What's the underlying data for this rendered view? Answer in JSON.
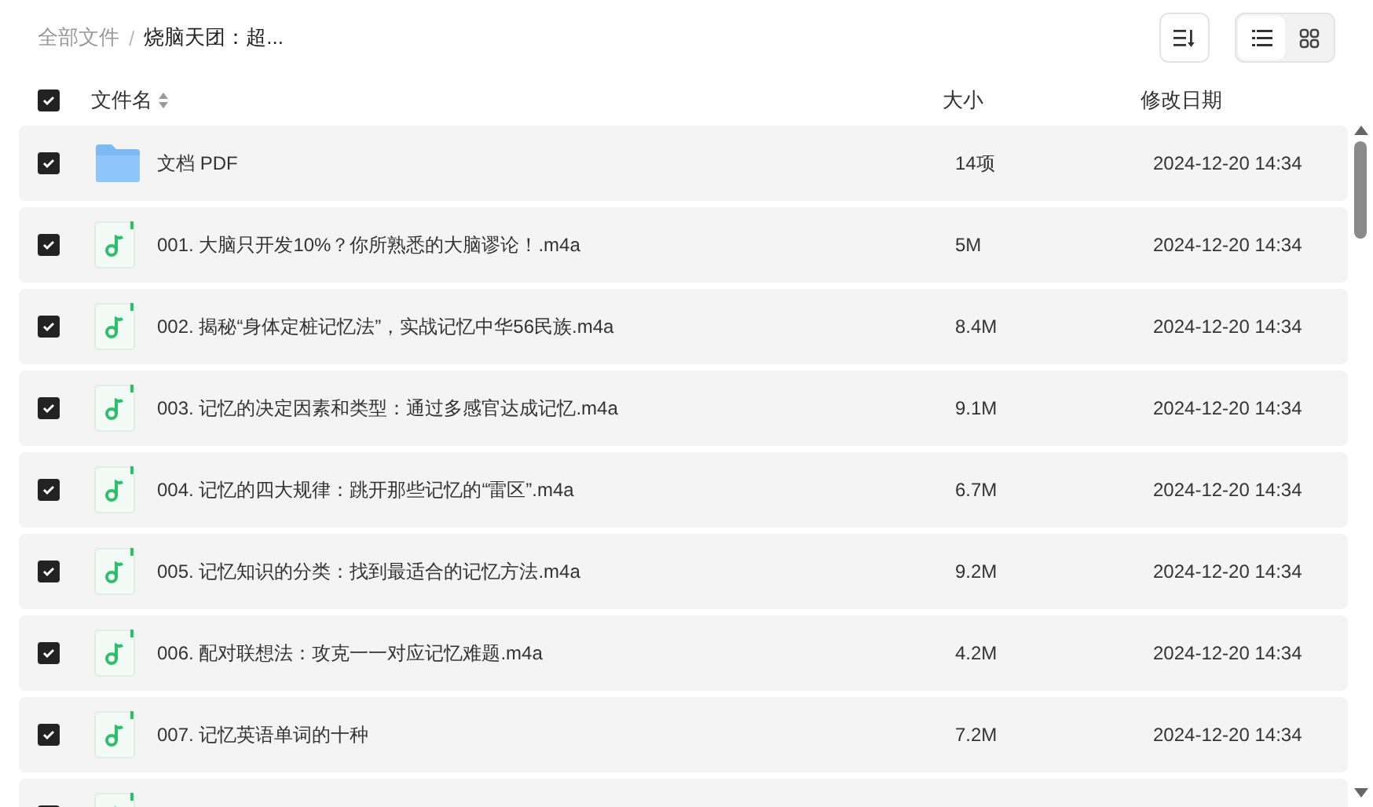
{
  "breadcrumb": {
    "separator": "/",
    "items": [
      {
        "label": "全部文件",
        "current": false
      },
      {
        "label": "烧脑天团：超...",
        "current": true
      }
    ]
  },
  "toolbar": {
    "views": [
      {
        "kind": "list",
        "selected": true
      },
      {
        "kind": "grid",
        "selected": false
      }
    ]
  },
  "header": {
    "checked": true,
    "columns": [
      "文件名",
      "大小",
      "修改日期"
    ]
  },
  "rows": [
    {
      "kind": "folder",
      "checked": true,
      "name": "文档 PDF",
      "size": "14项",
      "date": "2024-12-20 14:34"
    },
    {
      "kind": "audio",
      "checked": true,
      "name": "001. 大脑只开发10%？你所熟悉的大脑谬论！.m4a",
      "size": "5M",
      "date": "2024-12-20 14:34"
    },
    {
      "kind": "audio",
      "checked": true,
      "name": "002. 揭秘“身体定桩记忆法”，实战记忆中华56民族.m4a",
      "size": "8.4M",
      "date": "2024-12-20 14:34"
    },
    {
      "kind": "audio",
      "checked": true,
      "name": "003. 记忆的决定因素和类型：通过多感官达成记忆.m4a",
      "size": "9.1M",
      "date": "2024-12-20 14:34"
    },
    {
      "kind": "audio",
      "checked": true,
      "name": "004. 记忆的四大规律：跳开那些记忆的“雷区”.m4a",
      "size": "6.7M",
      "date": "2024-12-20 14:34"
    },
    {
      "kind": "audio",
      "checked": true,
      "name": "005. 记忆知识的分类：找到最适合的记忆方法.m4a",
      "size": "9.2M",
      "date": "2024-12-20 14:34"
    },
    {
      "kind": "audio",
      "checked": true,
      "name": "006. 配对联想法：攻克一一对应记忆难题.m4a",
      "size": "4.2M",
      "date": "2024-12-20 14:34"
    },
    {
      "kind": "audio",
      "checked": true,
      "name": "007. 记忆英语单词的十种",
      "size": "7.2M",
      "date": "2024-12-20 14:34"
    },
    {
      "kind": "audio",
      "checked": true
    }
  ]
}
